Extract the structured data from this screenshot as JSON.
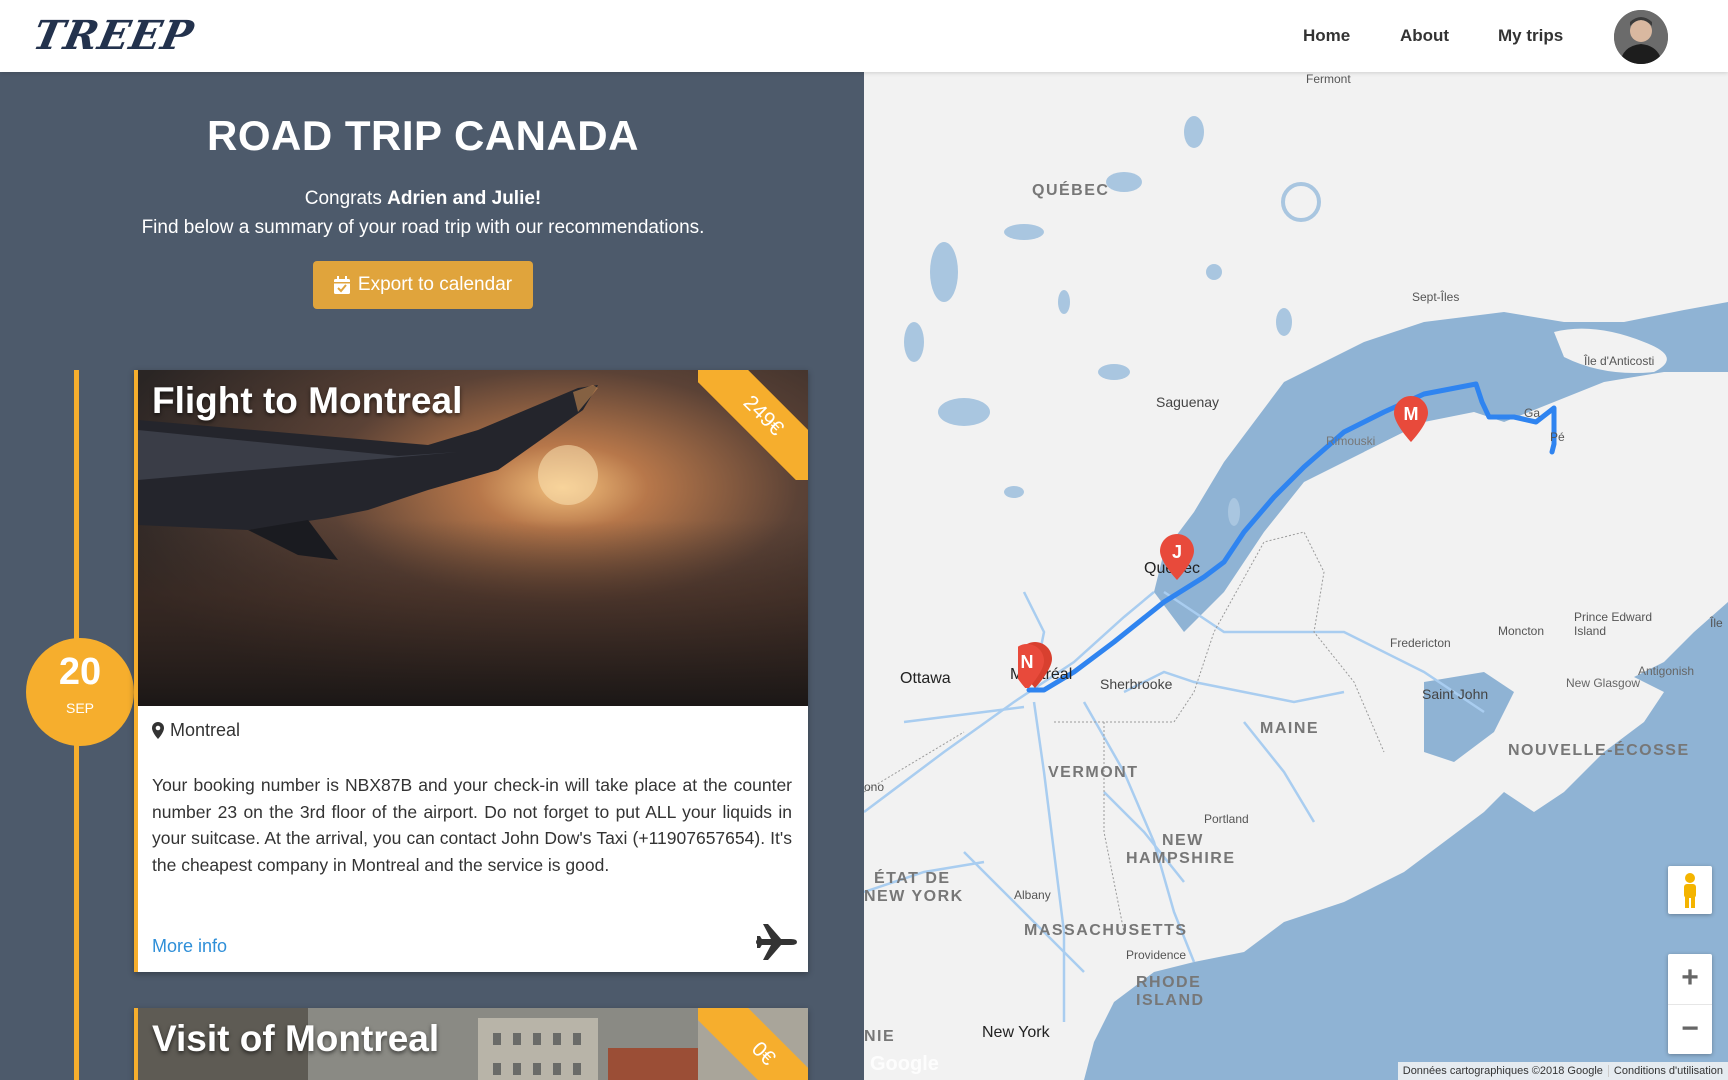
{
  "brand": {
    "logo": "TREEP"
  },
  "nav": {
    "home": "Home",
    "about": "About",
    "my_trips": "My trips"
  },
  "trip": {
    "title": "ROAD TRIP CANADA",
    "congrats_prefix": "Congrats",
    "names": "Adrien and Julie!",
    "summary": "Find below a summary of your road trip with our recommendations.",
    "export_label": "Export to calendar"
  },
  "timeline": {
    "date_day": "20",
    "date_month": "SEP"
  },
  "cards": [
    {
      "title": "Flight to Montreal",
      "price": "249€",
      "location": "Montreal",
      "description": "Your booking number is NBX87B and your check-in will take place at the counter number 23 on the 3rd floor of the airport. Do not forget to put ALL your liquids in your suitcase. At the arrival, you can contact John Dow's Taxi (+11907657654). It's the cheapest company in Montreal and the service is good.",
      "more_label": "More info",
      "icon": "airplane-icon"
    },
    {
      "title": "Visit of Montreal",
      "price": "0€"
    }
  ],
  "map": {
    "labels": {
      "quebec_region": "QUÉBEC",
      "sept_iles": "Sept-Îles",
      "fermont": "Fermont",
      "anticosti": "Île d'Anticosti",
      "saguenay": "Saguenay",
      "rimouski": "Rimouski",
      "gaspe_a": "Ga",
      "gaspe_b": "Pé",
      "quebec_city": "Québec",
      "montreal": "Montréal",
      "ottawa": "Ottawa",
      "sherbrooke": "Sherbrooke",
      "fredericton": "Fredericton",
      "moncton": "Moncton",
      "pei": "Prince Edward Island",
      "ile": "Île",
      "antigonish": "Antigonish",
      "new_glasgow": "New Glasgow",
      "saint_john": "Saint John",
      "maine": "MAINE",
      "nova_scotia": "NOUVELLE-ÉCOSSE",
      "vermont": "VERMONT",
      "portland": "Portland",
      "new_hampshire_1": "NEW",
      "new_hampshire_2": "HAMPSHIRE",
      "ny_state_1": "ÉTAT DE",
      "ny_state_2": "NEW YORK",
      "albany": "Albany",
      "massachusetts": "MASSACHUSETTS",
      "providence": "Providence",
      "rhode_1": "RHODE",
      "rhode_2": "ISLAND",
      "new_york": "New York",
      "nie": "NIE",
      "ono": "ono"
    },
    "markers": [
      "M",
      "J",
      "N"
    ],
    "attribution": "Données cartographiques ©2018 Google",
    "terms": "Conditions d'utilisation",
    "google": "Google",
    "zoom_in": "+",
    "zoom_out": "−"
  },
  "colors": {
    "accent": "#f6ae2d",
    "panel": "#4d5a6b",
    "route": "#2f84f0",
    "marker": "#e84a3b",
    "water": "#8fb3d4",
    "land": "#f2f2f2"
  }
}
